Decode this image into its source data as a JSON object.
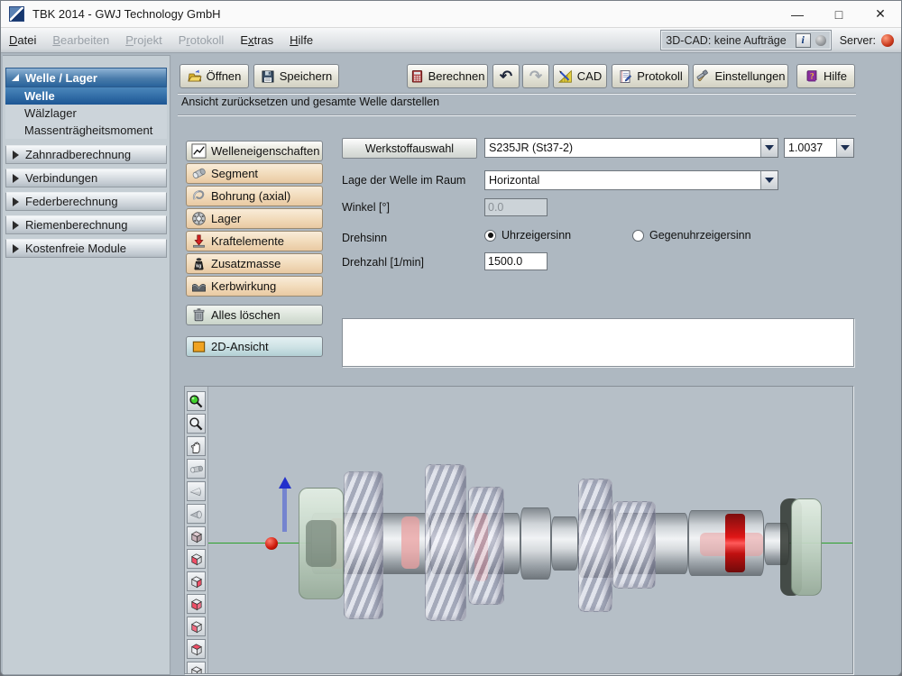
{
  "colors": {
    "axis_green": "#2da12d",
    "ring_red": "#e01616",
    "server_led_red": "#c93a1e",
    "selection_blue": "#1e5c96",
    "tan": "#f2dcbc",
    "teal": "#cfe3e6",
    "viewport_bg": "#b6bfc7"
  },
  "titlebar": {
    "title": "TBK 2014 - GWJ Technology GmbH",
    "minimize": "—",
    "maximize": "□",
    "close": "✕"
  },
  "menubar": {
    "items": [
      {
        "label": "Datei",
        "underline": 0,
        "enabled": true
      },
      {
        "label": "Bearbeiten",
        "underline": 0,
        "enabled": false
      },
      {
        "label": "Projekt",
        "underline": 0,
        "enabled": false
      },
      {
        "label": "Protokoll",
        "underline": 1,
        "enabled": false
      },
      {
        "label": "Extras",
        "underline": 1,
        "enabled": true
      },
      {
        "label": "Hilfe",
        "underline": 0,
        "enabled": true
      }
    ],
    "cad_status": "3D-CAD: keine Aufträge",
    "info_label": "i",
    "server_label": "Server:"
  },
  "sidebar": {
    "header": "Welle / Lager",
    "children": [
      "Welle",
      "Wälzlager",
      "Massenträgheitsmoment"
    ],
    "selected": "Welle",
    "sections": [
      "Zahnradberechnung",
      "Verbindungen",
      "Federberechnung",
      "Riemenberechnung",
      "Kostenfreie Module"
    ]
  },
  "toolbar": {
    "oeffnen": "Öffnen",
    "speichern": "Speichern",
    "berechnen": "Berechnen",
    "undo": "↶",
    "redo": "↷",
    "cad": "CAD",
    "protokoll": "Protokoll",
    "einstellungen": "Einstellungen",
    "hilfe": "Hilfe"
  },
  "hint": "Ansicht zurücksetzen und gesamte Welle darstellen",
  "tools": {
    "welleneigenschaften": "Welleneigenschaften",
    "segment": "Segment",
    "bohrung": "Bohrung (axial)",
    "lager": "Lager",
    "kraftelemente": "Kraftelemente",
    "zusatzmasse": "Zusatzmasse",
    "kerbwirkung": "Kerbwirkung",
    "alles_loeschen": "Alles löschen",
    "ansicht_2d": "2D-Ansicht"
  },
  "form": {
    "werkstoff_button": "Werkstoffauswahl",
    "material_value": "S235JR (St37-2)",
    "material_number": "1.0037",
    "lage_label": "Lage der Welle im Raum",
    "lage_value": "Horizontal",
    "winkel_label": "Winkel [°]",
    "winkel_value": "0.0",
    "drehsinn_label": "Drehsinn",
    "radio_cw": "Uhrzeigersinn",
    "radio_ccw": "Gegenuhrzeigersinn",
    "drehzahl_label": "Drehzahl [1/min]",
    "drehzahl_value": "1500.0"
  },
  "viewport": {
    "tools": [
      "zoom-fit",
      "zoom",
      "pan",
      "cylinder-view",
      "cone-view-1",
      "cone-view-2",
      "iso-view",
      "front-view",
      "right-view",
      "back-view",
      "left-view",
      "top-view",
      "bottom-view"
    ]
  }
}
